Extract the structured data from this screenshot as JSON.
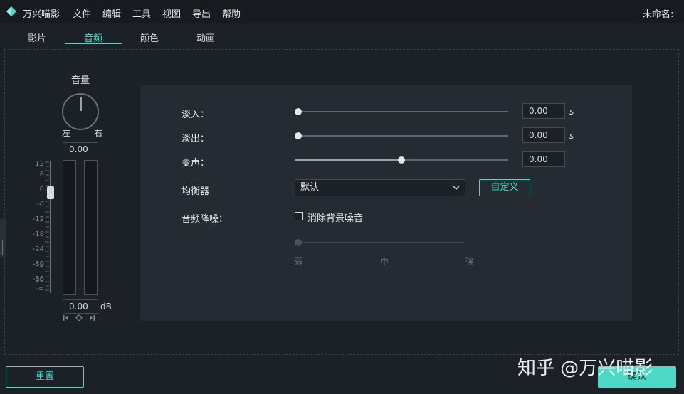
{
  "app": {
    "logo_icon": "filmora-logo-icon",
    "name": "万兴喵影",
    "document_title": "未命名:",
    "accent_color": "#4ed8c6"
  },
  "menu": [
    "文件",
    "编辑",
    "工具",
    "视图",
    "导出",
    "帮助"
  ],
  "tabs": [
    {
      "label": "影片",
      "active": false
    },
    {
      "label": "音频",
      "active": true
    },
    {
      "label": "颜色",
      "active": false
    },
    {
      "label": "动画",
      "active": false
    }
  ],
  "volume": {
    "title": "音量",
    "pan_left": "左",
    "pan_right": "右",
    "pan_value": "0.00",
    "db_value": "0.00",
    "db_unit": "dB",
    "scale": [
      "12",
      "6",
      "0",
      "-6",
      "-12",
      "-18",
      "-24",
      "-30",
      "-36",
      "-42",
      "-60",
      "-∞"
    ]
  },
  "audio": {
    "fade_in": {
      "label": "淡入：",
      "value": "0.00",
      "unit": "s",
      "level": 0.0
    },
    "fade_out": {
      "label": "淡出：",
      "value": "0.00",
      "unit": "s",
      "level": 0.0
    },
    "pitch": {
      "label": "变声：",
      "value": "0.00",
      "level": 0.5
    },
    "equalizer": {
      "label": "均衡器",
      "selected": "默认",
      "custom_label": "自定义"
    },
    "denoise": {
      "label": "音频降噪：",
      "checkbox_label": "消除背景噪音",
      "checked": false,
      "level": 0.0,
      "weak": "弱",
      "medium": "中",
      "strong": "強"
    }
  },
  "buttons": {
    "reset": "重置",
    "ok": "确认"
  },
  "watermark": "知乎 @万兴喵影"
}
